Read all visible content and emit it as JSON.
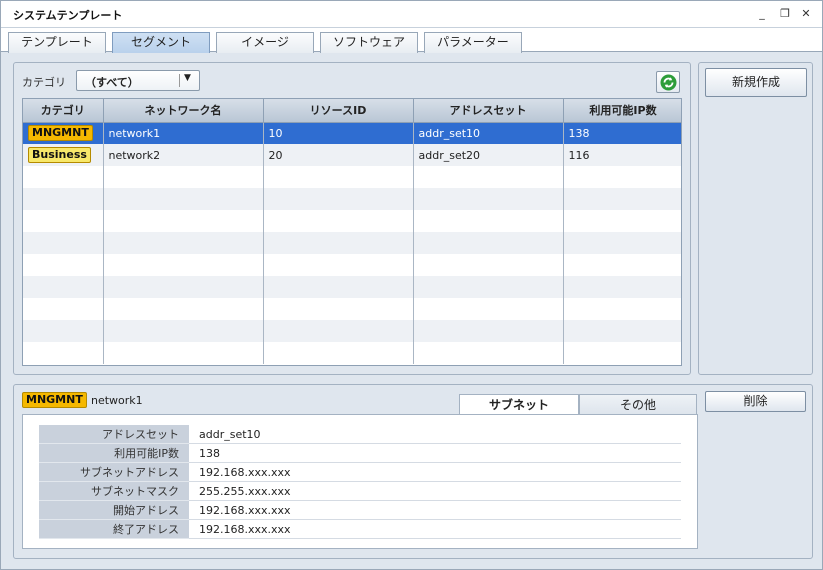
{
  "window": {
    "title": "システムテンプレート",
    "minimize": "_",
    "restore": "❐",
    "close": "✕"
  },
  "tabs": [
    "テンプレート",
    "セグメント",
    "イメージ",
    "ソフトウェア",
    "パラメーター"
  ],
  "filter": {
    "label": "カテゴリ",
    "value": "（すべて）"
  },
  "grid": {
    "headers": [
      "カテゴリ",
      "ネットワーク名",
      "リソースID",
      "アドレスセット",
      "利用可能IP数"
    ],
    "rows": [
      {
        "category": "MNGMNT",
        "network": "network1",
        "resource_id": "10",
        "address_set": "addr_set10",
        "available_ip": "138"
      },
      {
        "category": "Business",
        "network": "network2",
        "resource_id": "20",
        "address_set": "addr_set20",
        "available_ip": "116"
      }
    ]
  },
  "actions": {
    "new": "新規作成",
    "delete": "削除"
  },
  "detail": {
    "category": "MNGMNT",
    "network": "network1",
    "tabs": [
      "サブネット",
      "その他"
    ],
    "properties": [
      {
        "key": "アドレスセット",
        "value": "addr_set10"
      },
      {
        "key": "利用可能IP数",
        "value": "138"
      },
      {
        "key": "サブネットアドレス",
        "value": "192.168.xxx.xxx"
      },
      {
        "key": "サブネットマスク",
        "value": "255.255.xxx.xxx"
      },
      {
        "key": "開始アドレス",
        "value": "192.168.xxx.xxx"
      },
      {
        "key": "終了アドレス",
        "value": "192.168.xxx.xxx"
      }
    ]
  },
  "colors": {
    "selection": "#2f6dd1",
    "badge_mngmnt": "#f5b800",
    "badge_business": "#f8e86a"
  }
}
